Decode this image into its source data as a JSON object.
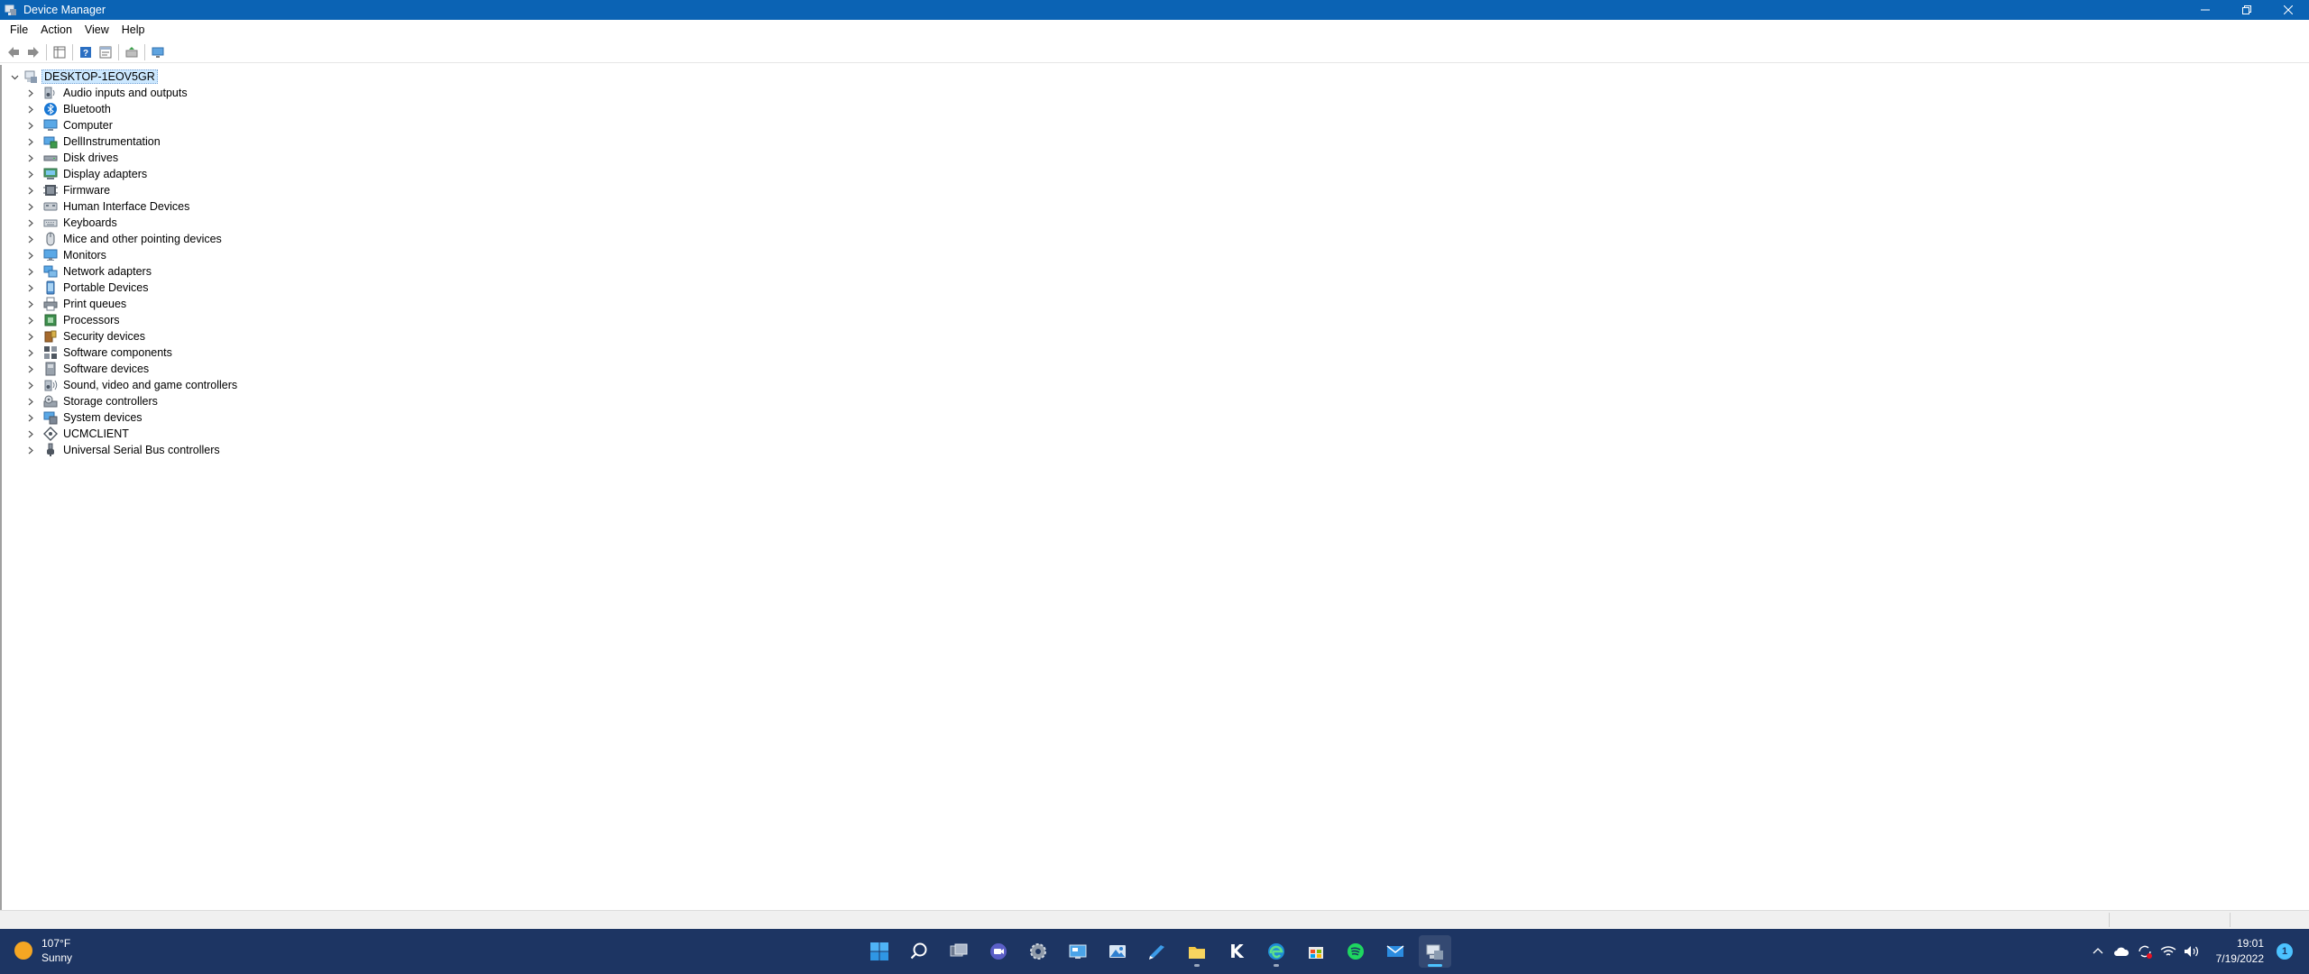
{
  "window": {
    "title": "Device Manager"
  },
  "menu": [
    "File",
    "Action",
    "View",
    "Help"
  ],
  "toolbar": {
    "buttons": [
      "back-arrow-icon",
      "forward-arrow-icon",
      "show-hide-tree-icon",
      "help-icon",
      "properties-icon",
      "update-driver-icon",
      "scan-hardware-icon"
    ]
  },
  "tree": {
    "root": "DESKTOP-1EOV5GR",
    "categories": [
      {
        "label": "Audio inputs and outputs",
        "icon": "speaker-icon"
      },
      {
        "label": "Bluetooth",
        "icon": "bluetooth-icon"
      },
      {
        "label": "Computer",
        "icon": "computer-icon"
      },
      {
        "label": "DellInstrumentation",
        "icon": "device-icon"
      },
      {
        "label": "Disk drives",
        "icon": "disk-drive-icon"
      },
      {
        "label": "Display adapters",
        "icon": "display-adapter-icon"
      },
      {
        "label": "Firmware",
        "icon": "firmware-icon"
      },
      {
        "label": "Human Interface Devices",
        "icon": "hid-icon"
      },
      {
        "label": "Keyboards",
        "icon": "keyboard-icon"
      },
      {
        "label": "Mice and other pointing devices",
        "icon": "mouse-icon"
      },
      {
        "label": "Monitors",
        "icon": "monitor-icon"
      },
      {
        "label": "Network adapters",
        "icon": "network-icon"
      },
      {
        "label": "Portable Devices",
        "icon": "portable-device-icon"
      },
      {
        "label": "Print queues",
        "icon": "printer-icon"
      },
      {
        "label": "Processors",
        "icon": "processor-icon"
      },
      {
        "label": "Security devices",
        "icon": "security-icon"
      },
      {
        "label": "Software components",
        "icon": "software-component-icon"
      },
      {
        "label": "Software devices",
        "icon": "software-device-icon"
      },
      {
        "label": "Sound, video and game controllers",
        "icon": "sound-icon"
      },
      {
        "label": "Storage controllers",
        "icon": "storage-icon"
      },
      {
        "label": "System devices",
        "icon": "system-icon"
      },
      {
        "label": "UCMCLIENT",
        "icon": "ucm-icon"
      },
      {
        "label": "Universal Serial Bus controllers",
        "icon": "usb-icon"
      }
    ]
  },
  "taskbar": {
    "weather": {
      "temp": "107°F",
      "condition": "Sunny"
    },
    "apps": [
      "start-icon",
      "search-icon",
      "task-view-icon",
      "teams-icon",
      "settings-icon",
      "control-panel-icon",
      "photos-icon",
      "pen-icon",
      "file-explorer-icon",
      "k-app-icon",
      "edge-icon",
      "store-icon",
      "spotify-icon",
      "mail-icon",
      "device-manager-icon"
    ],
    "time": "19:01",
    "date": "7/19/2022",
    "notifications": "1"
  },
  "colors": {
    "titlebar": "#0b63b4",
    "taskbar": "#1d3563",
    "selection": "#cce8ff",
    "accent": "#4cc2ff"
  }
}
